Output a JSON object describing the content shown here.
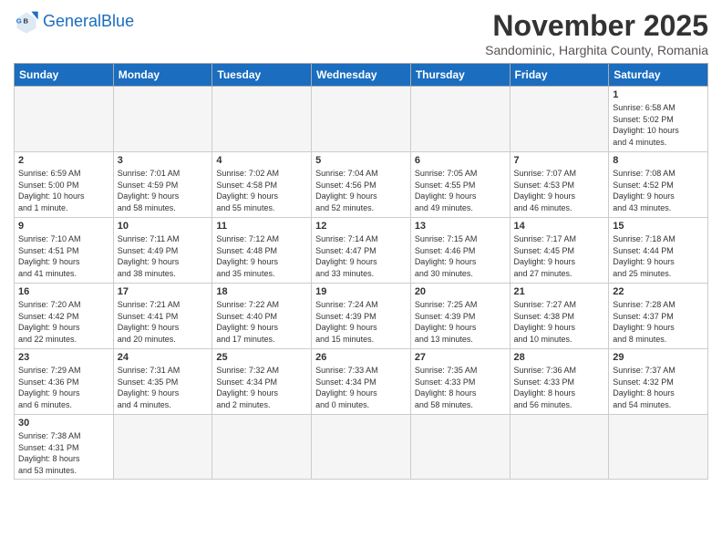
{
  "header": {
    "logo_general": "General",
    "logo_blue": "Blue",
    "title": "November 2025",
    "subtitle": "Sandominic, Harghita County, Romania"
  },
  "weekdays": [
    "Sunday",
    "Monday",
    "Tuesday",
    "Wednesday",
    "Thursday",
    "Friday",
    "Saturday"
  ],
  "weeks": [
    [
      {
        "day": "",
        "info": "",
        "empty": true
      },
      {
        "day": "",
        "info": "",
        "empty": true
      },
      {
        "day": "",
        "info": "",
        "empty": true
      },
      {
        "day": "",
        "info": "",
        "empty": true
      },
      {
        "day": "",
        "info": "",
        "empty": true
      },
      {
        "day": "",
        "info": "",
        "empty": true
      },
      {
        "day": "1",
        "info": "Sunrise: 6:58 AM\nSunset: 5:02 PM\nDaylight: 10 hours\nand 4 minutes."
      }
    ],
    [
      {
        "day": "2",
        "info": "Sunrise: 6:59 AM\nSunset: 5:00 PM\nDaylight: 10 hours\nand 1 minute."
      },
      {
        "day": "3",
        "info": "Sunrise: 7:01 AM\nSunset: 4:59 PM\nDaylight: 9 hours\nand 58 minutes."
      },
      {
        "day": "4",
        "info": "Sunrise: 7:02 AM\nSunset: 4:58 PM\nDaylight: 9 hours\nand 55 minutes."
      },
      {
        "day": "5",
        "info": "Sunrise: 7:04 AM\nSunset: 4:56 PM\nDaylight: 9 hours\nand 52 minutes."
      },
      {
        "day": "6",
        "info": "Sunrise: 7:05 AM\nSunset: 4:55 PM\nDaylight: 9 hours\nand 49 minutes."
      },
      {
        "day": "7",
        "info": "Sunrise: 7:07 AM\nSunset: 4:53 PM\nDaylight: 9 hours\nand 46 minutes."
      },
      {
        "day": "8",
        "info": "Sunrise: 7:08 AM\nSunset: 4:52 PM\nDaylight: 9 hours\nand 43 minutes."
      }
    ],
    [
      {
        "day": "9",
        "info": "Sunrise: 7:10 AM\nSunset: 4:51 PM\nDaylight: 9 hours\nand 41 minutes."
      },
      {
        "day": "10",
        "info": "Sunrise: 7:11 AM\nSunset: 4:49 PM\nDaylight: 9 hours\nand 38 minutes."
      },
      {
        "day": "11",
        "info": "Sunrise: 7:12 AM\nSunset: 4:48 PM\nDaylight: 9 hours\nand 35 minutes."
      },
      {
        "day": "12",
        "info": "Sunrise: 7:14 AM\nSunset: 4:47 PM\nDaylight: 9 hours\nand 33 minutes."
      },
      {
        "day": "13",
        "info": "Sunrise: 7:15 AM\nSunset: 4:46 PM\nDaylight: 9 hours\nand 30 minutes."
      },
      {
        "day": "14",
        "info": "Sunrise: 7:17 AM\nSunset: 4:45 PM\nDaylight: 9 hours\nand 27 minutes."
      },
      {
        "day": "15",
        "info": "Sunrise: 7:18 AM\nSunset: 4:44 PM\nDaylight: 9 hours\nand 25 minutes."
      }
    ],
    [
      {
        "day": "16",
        "info": "Sunrise: 7:20 AM\nSunset: 4:42 PM\nDaylight: 9 hours\nand 22 minutes."
      },
      {
        "day": "17",
        "info": "Sunrise: 7:21 AM\nSunset: 4:41 PM\nDaylight: 9 hours\nand 20 minutes."
      },
      {
        "day": "18",
        "info": "Sunrise: 7:22 AM\nSunset: 4:40 PM\nDaylight: 9 hours\nand 17 minutes."
      },
      {
        "day": "19",
        "info": "Sunrise: 7:24 AM\nSunset: 4:39 PM\nDaylight: 9 hours\nand 15 minutes."
      },
      {
        "day": "20",
        "info": "Sunrise: 7:25 AM\nSunset: 4:39 PM\nDaylight: 9 hours\nand 13 minutes."
      },
      {
        "day": "21",
        "info": "Sunrise: 7:27 AM\nSunset: 4:38 PM\nDaylight: 9 hours\nand 10 minutes."
      },
      {
        "day": "22",
        "info": "Sunrise: 7:28 AM\nSunset: 4:37 PM\nDaylight: 9 hours\nand 8 minutes."
      }
    ],
    [
      {
        "day": "23",
        "info": "Sunrise: 7:29 AM\nSunset: 4:36 PM\nDaylight: 9 hours\nand 6 minutes."
      },
      {
        "day": "24",
        "info": "Sunrise: 7:31 AM\nSunset: 4:35 PM\nDaylight: 9 hours\nand 4 minutes."
      },
      {
        "day": "25",
        "info": "Sunrise: 7:32 AM\nSunset: 4:34 PM\nDaylight: 9 hours\nand 2 minutes."
      },
      {
        "day": "26",
        "info": "Sunrise: 7:33 AM\nSunset: 4:34 PM\nDaylight: 9 hours\nand 0 minutes."
      },
      {
        "day": "27",
        "info": "Sunrise: 7:35 AM\nSunset: 4:33 PM\nDaylight: 8 hours\nand 58 minutes."
      },
      {
        "day": "28",
        "info": "Sunrise: 7:36 AM\nSunset: 4:33 PM\nDaylight: 8 hours\nand 56 minutes."
      },
      {
        "day": "29",
        "info": "Sunrise: 7:37 AM\nSunset: 4:32 PM\nDaylight: 8 hours\nand 54 minutes."
      }
    ],
    [
      {
        "day": "30",
        "info": "Sunrise: 7:38 AM\nSunset: 4:31 PM\nDaylight: 8 hours\nand 53 minutes."
      },
      {
        "day": "",
        "info": "",
        "empty": true
      },
      {
        "day": "",
        "info": "",
        "empty": true
      },
      {
        "day": "",
        "info": "",
        "empty": true
      },
      {
        "day": "",
        "info": "",
        "empty": true
      },
      {
        "day": "",
        "info": "",
        "empty": true
      },
      {
        "day": "",
        "info": "",
        "empty": true
      }
    ]
  ]
}
